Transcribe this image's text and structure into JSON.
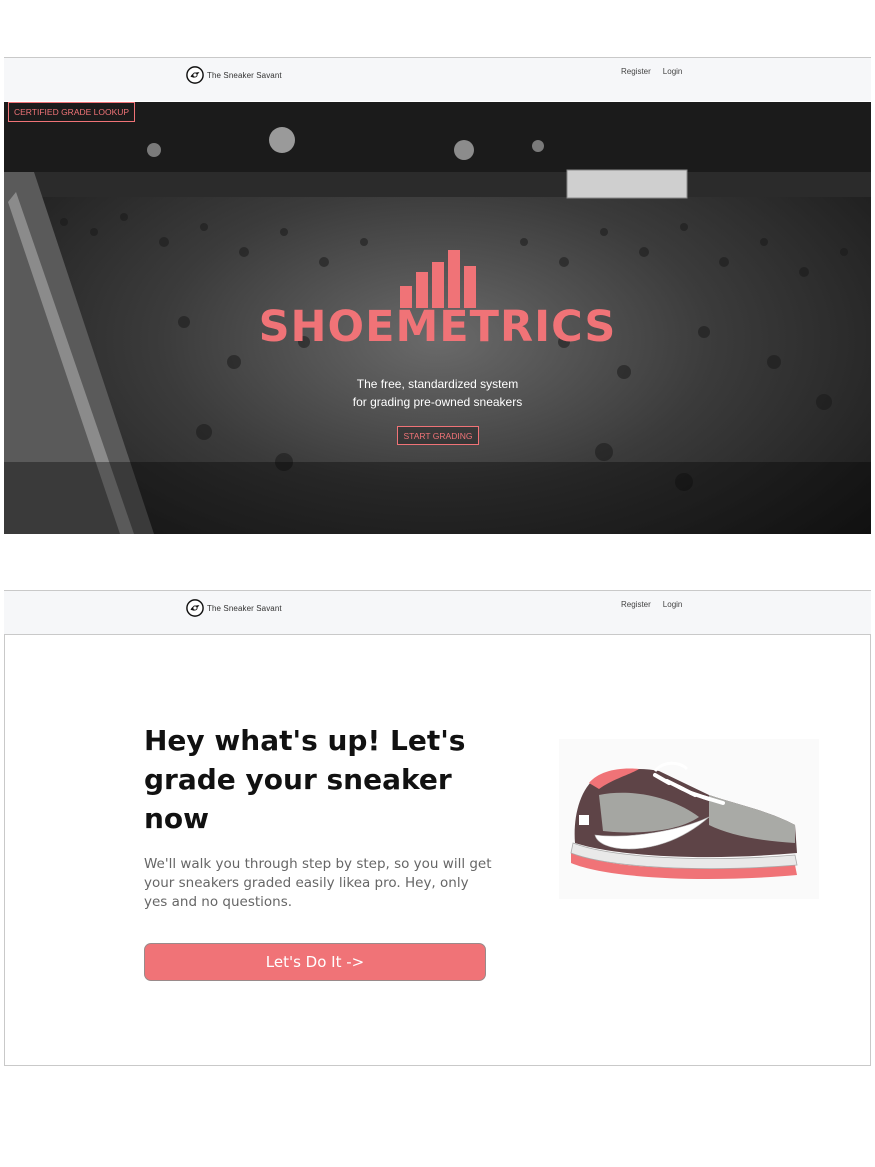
{
  "brand": {
    "name": "The Sneaker Savant",
    "logo_icon": "sneaker-savant-logo-icon"
  },
  "nav": {
    "register": "Register",
    "login": "Login"
  },
  "hero": {
    "tag": "CERTIFIED GRADE LOOKUP",
    "logo_icon": "bar-chart-icon",
    "title": "SHOEMETRICS",
    "subtitle_line1": "The free, standardized system",
    "subtitle_line2": "for grading pre-owned sneakers",
    "cta": "START GRADING",
    "background_image": "sneaker-convention-crowd-photo"
  },
  "grade": {
    "headline": "Hey what's up! Let's grade your sneaker now",
    "body": "We'll walk you through step by step, so you will get your sneakers graded easily likea pro. Hey, only yes and no questions.",
    "cta": "Let's Do It  ->",
    "image": "sneaker-illustration"
  },
  "colors": {
    "accent": "#f07377",
    "nav_bg": "#f6f7f9",
    "heading": "#111111",
    "body": "#666666"
  }
}
